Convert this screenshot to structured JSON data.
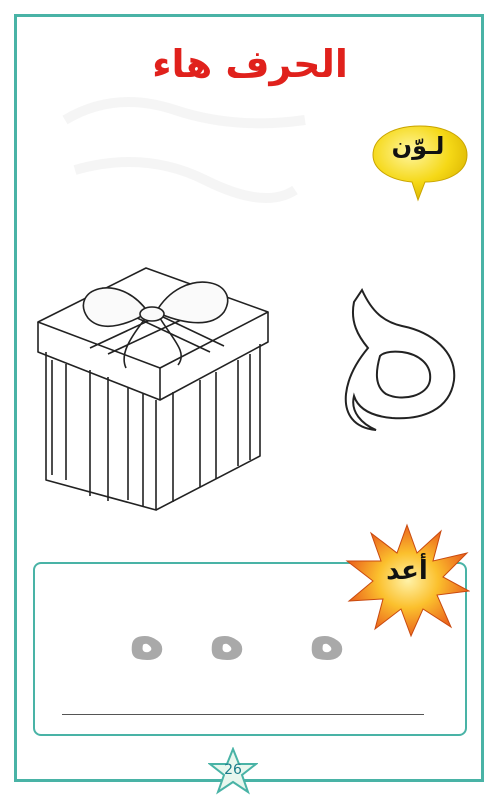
{
  "worksheet": {
    "title": "الحرف هاء",
    "instruction_color": "لـوّن",
    "instruction_repeat": "أعد",
    "letter": "ه",
    "trace_letters": [
      "ه",
      "ه",
      "ه"
    ],
    "page_number": "26"
  },
  "colors": {
    "frame": "#49b3a6",
    "title": "#e0211c",
    "bubble": "#f5d816",
    "starburst": "#f7941d",
    "trace_letter": "#a9a9a9"
  },
  "icons": {
    "picture": "gift-box",
    "bubble": "speech-bubble",
    "badge": "starburst",
    "page_badge": "star"
  }
}
